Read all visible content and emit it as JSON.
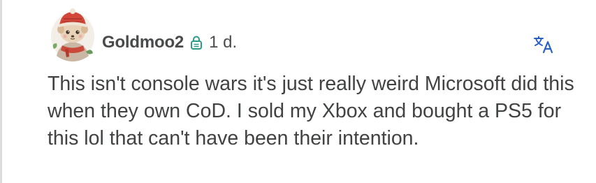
{
  "comment": {
    "author": "Goldmoo2",
    "timestamp": "1 d.",
    "text": "This isn't console wars it's just really weird Microsoft did this when they own CoD. I sold my Xbox and bought a PS5 for this lol that can't have been their intention."
  },
  "icons": {
    "avatar": "avatar-illustration",
    "badge": "moderator-lock-icon",
    "translate": "translate-icon"
  },
  "colors": {
    "badge": "#2e9a8a",
    "translate": "#2a5fc4"
  }
}
